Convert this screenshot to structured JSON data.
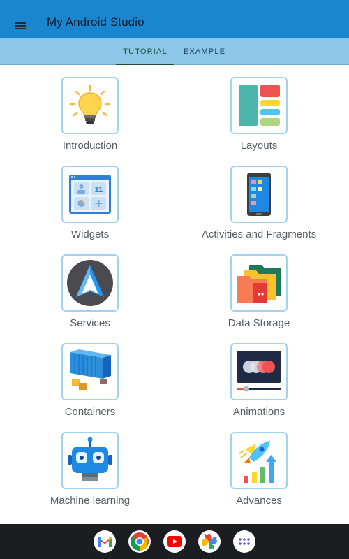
{
  "app": {
    "title": "My Android Studio"
  },
  "tabs": [
    {
      "label": "TUTORIAL",
      "active": true
    },
    {
      "label": "EXAMPLE",
      "active": false
    }
  ],
  "topics": [
    {
      "label": "Introduction",
      "icon": "lightbulb-icon"
    },
    {
      "label": "Layouts",
      "icon": "layout-blocks-icon"
    },
    {
      "label": "Widgets",
      "icon": "widgets-icon"
    },
    {
      "label": "Activities and Fragments",
      "icon": "phone-screen-icon"
    },
    {
      "label": "Services",
      "icon": "navigation-arrow-icon"
    },
    {
      "label": "Data Storage",
      "icon": "folders-icon"
    },
    {
      "label": "Containers",
      "icon": "shipping-container-icon"
    },
    {
      "label": "Animations",
      "icon": "animation-player-icon"
    },
    {
      "label": "Machine learning",
      "icon": "robot-icon"
    },
    {
      "label": "Advances",
      "icon": "rocket-growth-icon"
    }
  ],
  "dock": [
    {
      "name": "gmail-icon"
    },
    {
      "name": "chrome-icon"
    },
    {
      "name": "youtube-icon"
    },
    {
      "name": "photos-icon"
    },
    {
      "name": "app-drawer-icon"
    }
  ],
  "colors": {
    "appbar": "#1a86cf",
    "tabbar": "#8cc7ea",
    "card_border": "#9fd4ef",
    "navbar": "#1b1d20"
  }
}
